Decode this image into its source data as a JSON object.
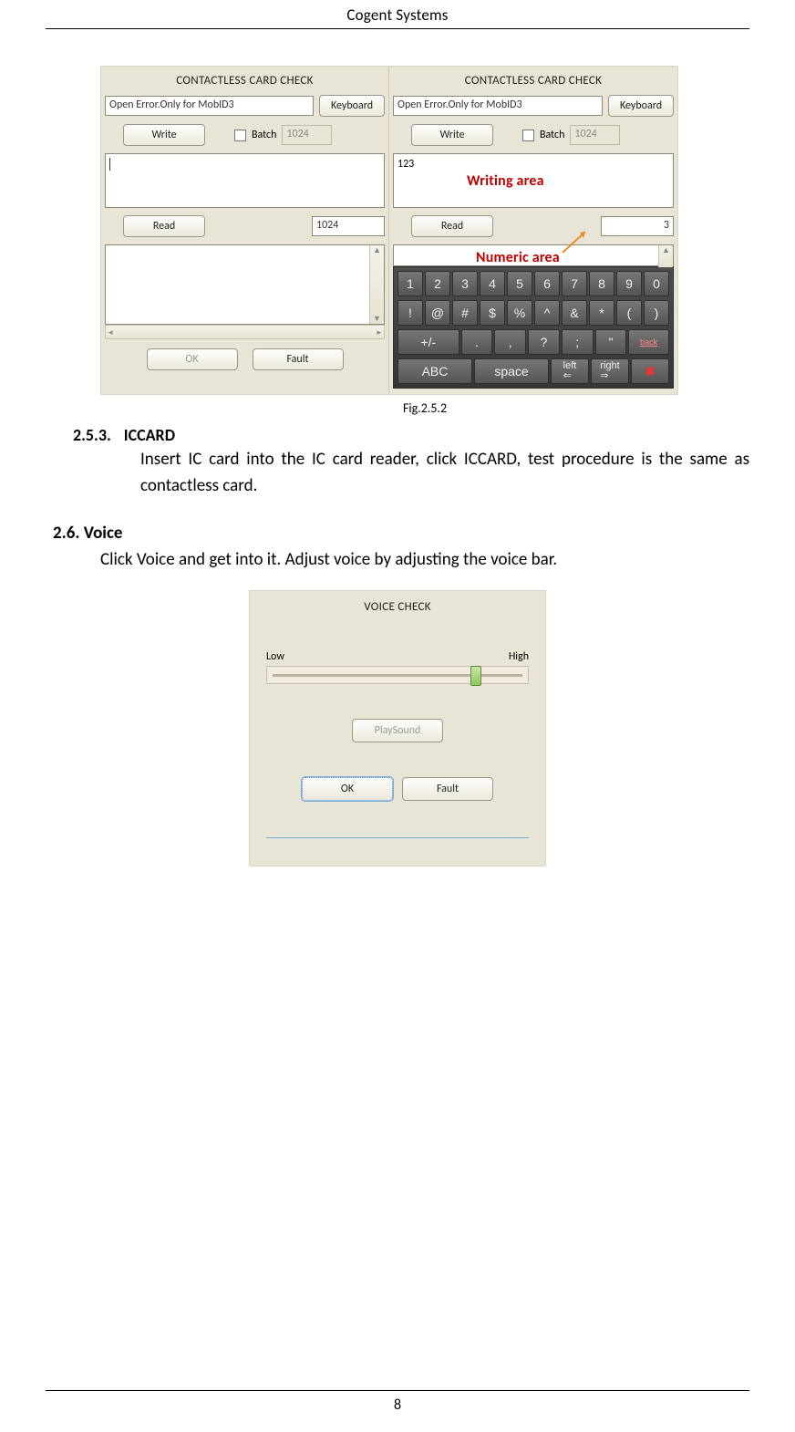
{
  "header": "Cogent Systems",
  "panelLeft": {
    "title": "CONTACTLESS CARD CHECK",
    "status": "Open Error.Only for MobID3",
    "keyboardBtn": "Keyboard",
    "writeBtn": "Write",
    "batchLabel": "Batch",
    "batchVal": "1024",
    "writingValue": "",
    "readBtn": "Read",
    "readVal": "1024",
    "okBtn": "OK",
    "faultBtn": "Fault"
  },
  "panelRight": {
    "title": "CONTACTLESS CARD CHECK",
    "status": "Open Error.Only for MobID3",
    "keyboardBtn": "Keyboard",
    "writeBtn": "Write",
    "batchLabel": "Batch",
    "batchVal": "1024",
    "writingValue": "123",
    "writingArea": "Writing area",
    "readBtn": "Read",
    "readVal": "3",
    "numericArea": "Numeric area"
  },
  "keyboard": {
    "row1": [
      "1",
      "2",
      "3",
      "4",
      "5",
      "6",
      "7",
      "8",
      "9",
      "0"
    ],
    "row2": [
      "!",
      "@",
      "#",
      "$",
      "%",
      "^",
      "&",
      "*",
      "(",
      ")"
    ],
    "row3": [
      "+/-",
      ".",
      ",",
      "?",
      ";",
      "\"",
      "back"
    ],
    "row4": [
      "ABC",
      "space",
      "left",
      "right",
      "✖"
    ]
  },
  "figCaption": "Fig.2.5.2",
  "sec253": {
    "num": "2.5.3.",
    "title": "ICCARD",
    "body": "Insert IC card into the IC card reader, click ICCARD, test procedure is the same as contactless card."
  },
  "sec26": {
    "num": "2.6.",
    "title": "Voice",
    "body": "Click Voice and get into it. Adjust voice by adjusting the voice bar."
  },
  "voice": {
    "title": "VOICE CHECK",
    "low": "Low",
    "high": "High",
    "play": "PlaySound",
    "ok": "OK",
    "fault": "Fault"
  },
  "pageNumber": "8"
}
